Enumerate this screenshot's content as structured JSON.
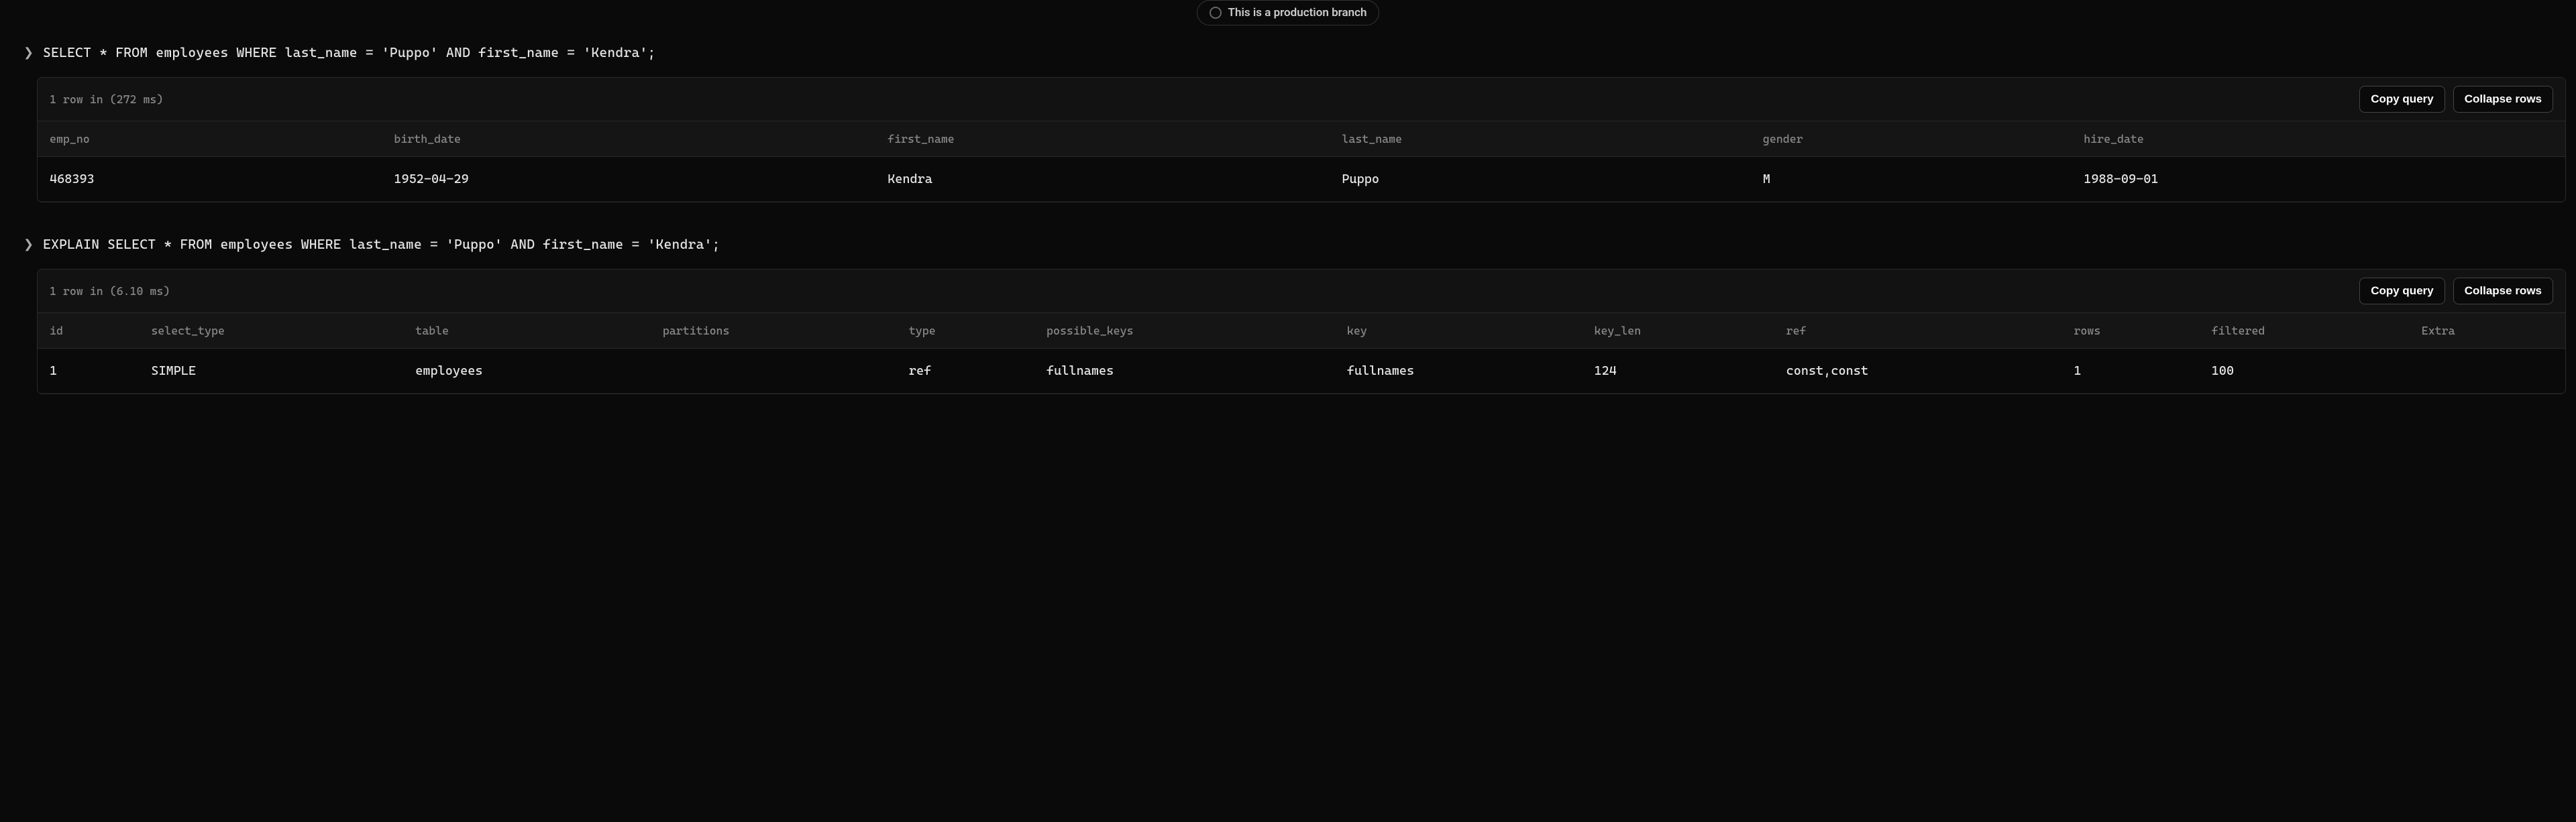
{
  "badge": {
    "label": "This is a production branch"
  },
  "buttons": {
    "copy": "Copy query",
    "collapse": "Collapse rows"
  },
  "queries": [
    {
      "sql": "SELECT * FROM employees WHERE last_name = 'Puppo' AND first_name = 'Kendra';",
      "summary": "1 row in (272 ms)",
      "columns": [
        "emp_no",
        "birth_date",
        "first_name",
        "last_name",
        "gender",
        "hire_date"
      ],
      "rows": [
        [
          "468393",
          "1952-04-29",
          "Kendra",
          "Puppo",
          "M",
          "1988-09-01"
        ]
      ]
    },
    {
      "sql": "EXPLAIN SELECT * FROM employees WHERE last_name = 'Puppo' AND first_name = 'Kendra';",
      "summary": "1 row in (6.10 ms)",
      "columns": [
        "id",
        "select_type",
        "table",
        "partitions",
        "type",
        "possible_keys",
        "key",
        "key_len",
        "ref",
        "rows",
        "filtered",
        "Extra"
      ],
      "rows": [
        [
          "1",
          "SIMPLE",
          "employees",
          "",
          "ref",
          "fullnames",
          "fullnames",
          "124",
          "const,const",
          "1",
          "100",
          ""
        ]
      ]
    }
  ]
}
